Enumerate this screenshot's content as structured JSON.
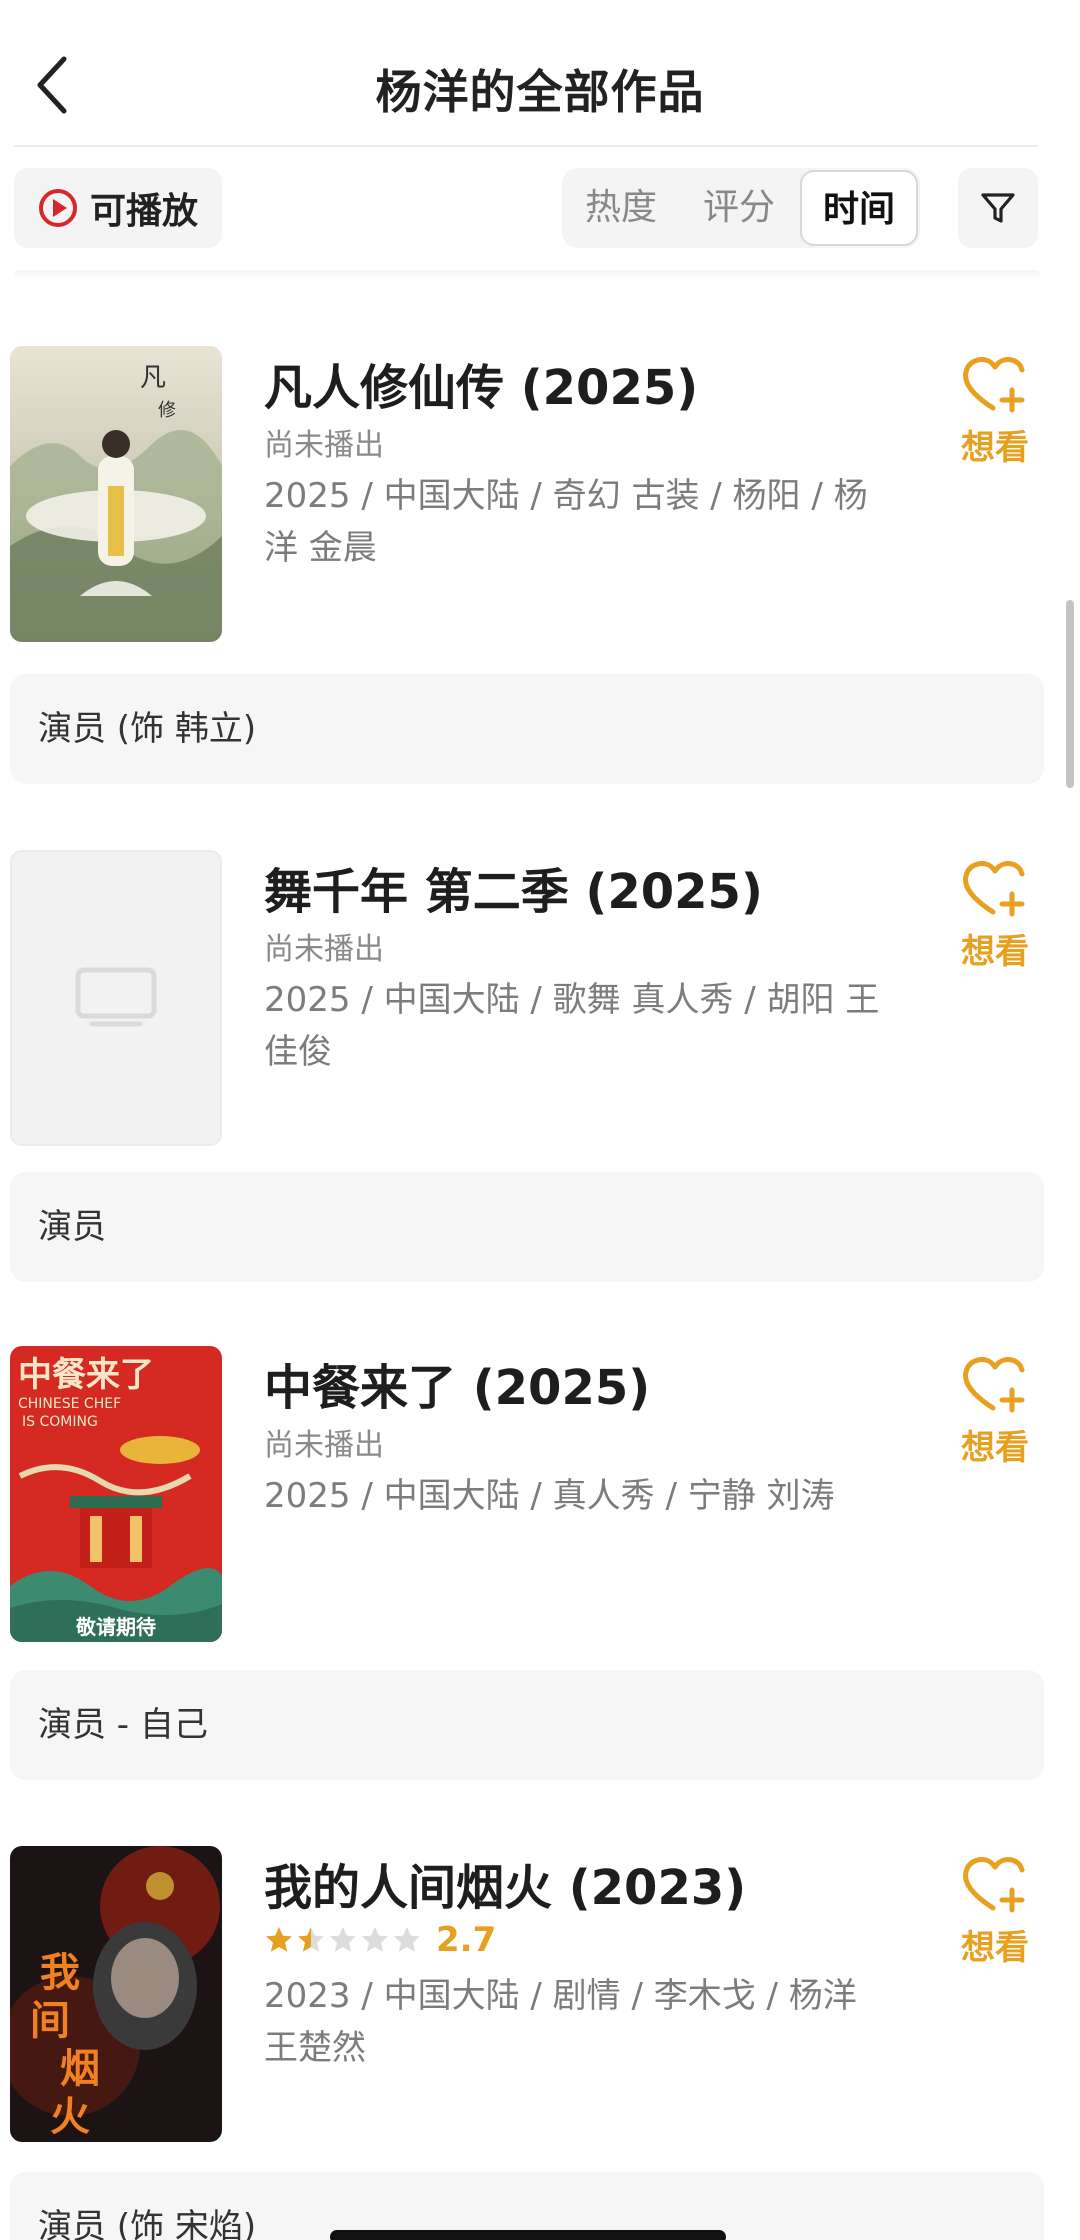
{
  "header": {
    "title": "杨洋的全部作品"
  },
  "filters": {
    "playable_label": "可播放",
    "sort_options": [
      "热度",
      "评分",
      "时间"
    ],
    "active_sort": "时间"
  },
  "colors": {
    "accent": "#e8a020",
    "play_red": "#d8262e"
  },
  "items": [
    {
      "title": "凡人修仙传 (2025)",
      "status": "尚未播出",
      "meta": "2025 / 中国大陆 / 奇幻 古装 / 杨阳 / 杨洋 金晨",
      "want_label": "想看",
      "role": "演员 (饰 韩立)"
    },
    {
      "title": "舞千年 第二季 (2025)",
      "status": "尚未播出",
      "meta": "2025 / 中国大陆 / 歌舞 真人秀 / 胡阳 王佳俊",
      "want_label": "想看",
      "role": "演员"
    },
    {
      "title": "中餐来了 (2025)",
      "status": "尚未播出",
      "meta": "2025 / 中国大陆 / 真人秀 / 宁静 刘涛",
      "want_label": "想看",
      "role": "演员 - 自己",
      "poster_text": {
        "top": "中餐来了",
        "sub1": "CHINESE CHEF",
        "sub2": "IS COMING",
        "bottom": "敬请期待"
      }
    },
    {
      "title": "我的人间烟火 (2023)",
      "rating": "2.7",
      "stars_filled": 1.5,
      "meta": "2023 / 中国大陆 / 剧情 / 李木戈 / 杨洋 王楚然",
      "want_label": "想看",
      "role": "演员 (饰 宋焰)",
      "poster_text": {
        "title": "我的人间烟火"
      }
    }
  ]
}
